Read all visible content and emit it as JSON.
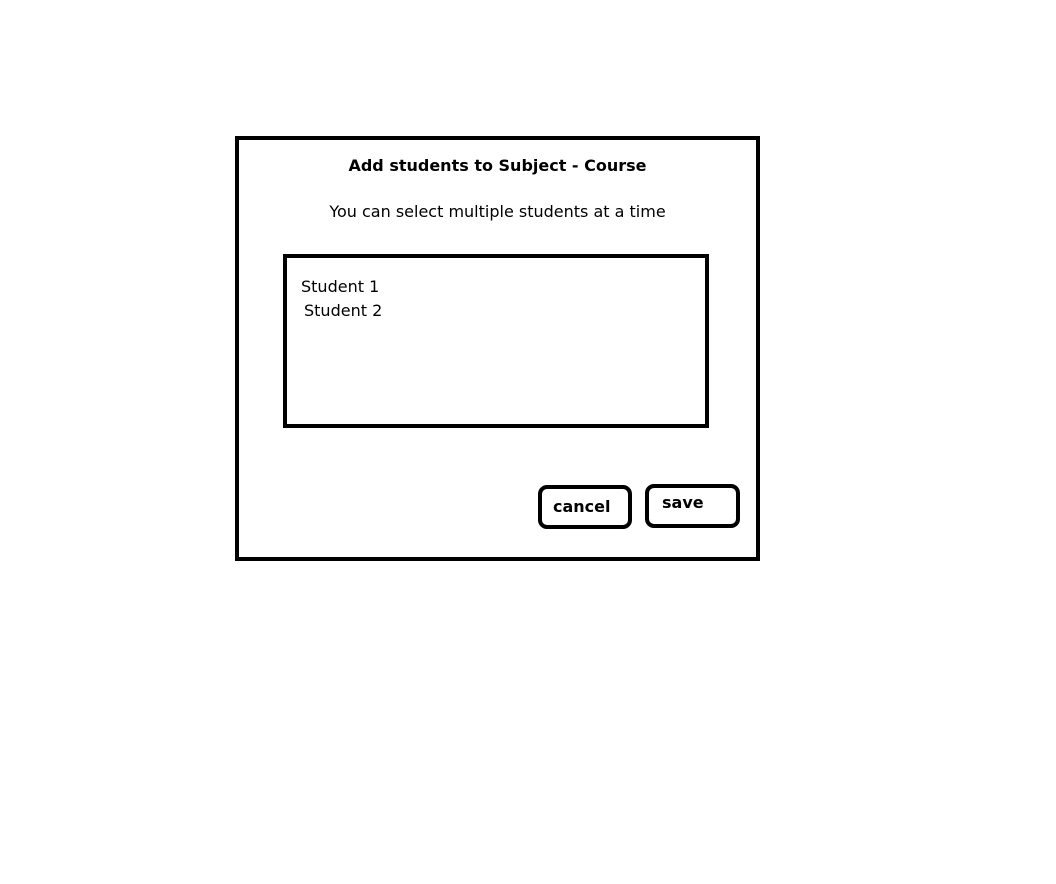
{
  "dialog": {
    "title": "Add students to Subject - Course",
    "subtitle": "You can select multiple students at a time",
    "students": [
      {
        "label": "Student 1"
      },
      {
        "label": "Student 2"
      }
    ],
    "buttons": {
      "cancel_label": "cancel",
      "save_label": "save"
    }
  }
}
